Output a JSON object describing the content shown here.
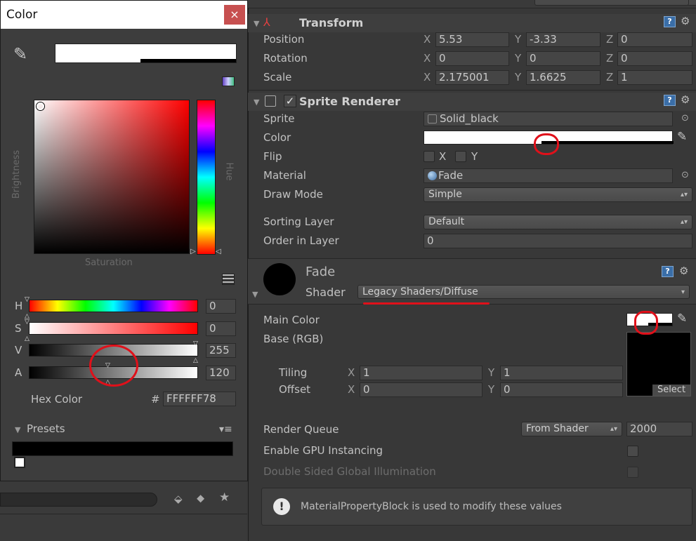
{
  "inspector": {
    "transform": {
      "title": "Transform",
      "rows": [
        {
          "label": "Position",
          "x": "5.53",
          "y": "-3.33",
          "z": "0"
        },
        {
          "label": "Rotation",
          "x": "0",
          "y": "0",
          "z": "0"
        },
        {
          "label": "Scale",
          "x": "2.175001",
          "y": "1.6625",
          "z": "1"
        }
      ],
      "axis_x": "X",
      "axis_y": "Y",
      "axis_z": "Z"
    },
    "sprite_renderer": {
      "title": "Sprite Renderer",
      "sprite_label": "Sprite",
      "sprite_value": "Solid_black",
      "color_label": "Color",
      "flip_label": "Flip",
      "flip_x": "X",
      "flip_y": "Y",
      "material_label": "Material",
      "material_value": "Fade",
      "draw_mode_label": "Draw Mode",
      "draw_mode_value": "Simple",
      "sorting_layer_label": "Sorting Layer",
      "sorting_layer_value": "Default",
      "order_label": "Order in Layer",
      "order_value": "0"
    },
    "material": {
      "name": "Fade",
      "shader_label": "Shader",
      "shader_value": "Legacy Shaders/Diffuse",
      "main_color_label": "Main Color",
      "base_label": "Base (RGB)",
      "tiling_label": "Tiling",
      "offset_label": "Offset",
      "tiling_x": "1",
      "tiling_y": "1",
      "offset_x": "0",
      "offset_y": "0",
      "select_label": "Select",
      "render_queue_label": "Render Queue",
      "render_queue_mode": "From Shader",
      "render_queue_value": "2000",
      "gpu_instancing_label": "Enable GPU Instancing",
      "double_sided_label": "Double Sided Global Illumination",
      "info_message": "MaterialPropertyBlock is used to modify these values"
    }
  },
  "color_window": {
    "title": "Color",
    "close_label": "×",
    "brightness_label": "Brightness",
    "hue_label": "Hue",
    "saturation_label": "Saturation",
    "h_label": "H",
    "h_value": "0",
    "s_label": "S",
    "s_value": "0",
    "v_label": "V",
    "v_value": "255",
    "a_label": "A",
    "a_value": "120",
    "hex_label": "Hex Color",
    "hex_hash": "#",
    "hex_value": "FFFFFF78",
    "presets_label": "Presets"
  },
  "icons": {
    "eyedropper": "eyedropper-icon",
    "help": "help-icon",
    "gear": "gear-icon",
    "transform": "transform-axes-icon"
  },
  "colors": {
    "panel_bg": "#383838",
    "accent_mark": "#e0101a",
    "selected_color": "#ffffff"
  }
}
